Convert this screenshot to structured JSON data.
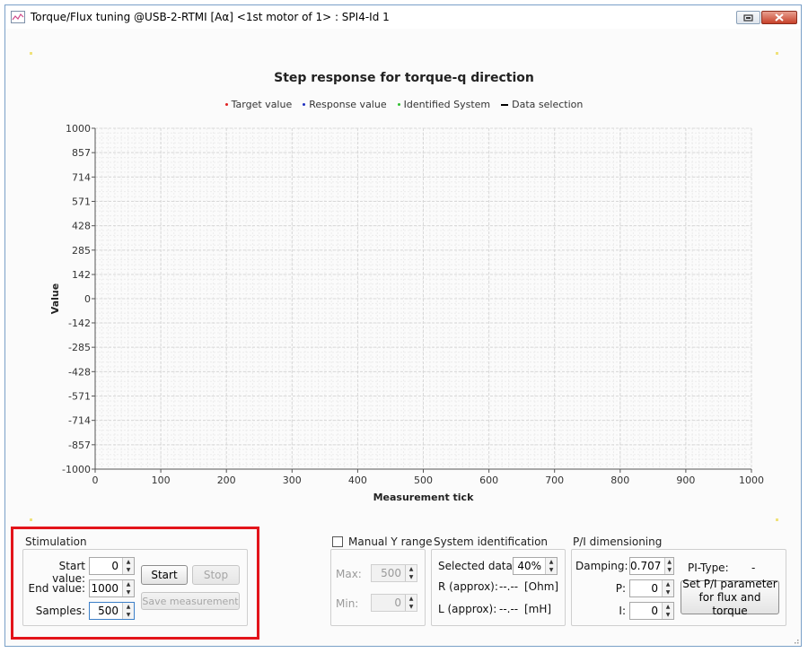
{
  "window": {
    "title": "Torque/Flux tuning @USB-2-RTMI [Aα] <1st motor of 1> : SPI4-Id 1"
  },
  "chart_data": {
    "type": "line",
    "title": "Step response for torque-q direction",
    "xlabel": "Measurement tick",
    "ylabel": "Value",
    "xlim": [
      0,
      1000
    ],
    "ylim": [
      -1000,
      1000
    ],
    "x_ticks": [
      "0",
      "100",
      "200",
      "300",
      "400",
      "500",
      "600",
      "700",
      "800",
      "900",
      "1000"
    ],
    "y_ticks": [
      "1000",
      "857",
      "714",
      "571",
      "428",
      "285",
      "142",
      "0",
      "-142",
      "-285",
      "-428",
      "-571",
      "-714",
      "-857",
      "-1000"
    ],
    "grid": true,
    "legend_position": "top-center",
    "series": [
      {
        "name": "Target value",
        "color": "#e02020",
        "values": []
      },
      {
        "name": "Response value",
        "color": "#2030c0",
        "values": []
      },
      {
        "name": "Identified System",
        "color": "#30c030",
        "values": []
      },
      {
        "name": "Data selection",
        "color": "#000000",
        "values": []
      }
    ]
  },
  "stimulation": {
    "group_label": "Stimulation",
    "start_label": "Start value:",
    "start_value": "0",
    "end_label": "End value:",
    "end_value": "1000",
    "samples_label": "Samples:",
    "samples_value": "500",
    "start_button": "Start",
    "stop_button": "Stop",
    "save_button": "Save measurement"
  },
  "yrange": {
    "checkbox_label": "Manual Y  range",
    "max_label": "Max:",
    "max_value": "500",
    "min_label": "Min:",
    "min_value": "0"
  },
  "sysid": {
    "group_label": "System identification",
    "selected_label": "Selected data:",
    "selected_value": "40%",
    "r_label": "R (approx):",
    "r_value": "--.--",
    "r_unit": "[Ohm]",
    "l_label": "L (approx):",
    "l_value": "--.--",
    "l_unit": "[mH]"
  },
  "pi": {
    "group_label": "P/I dimensioning",
    "damping_label": "Damping:",
    "damping_value": "0.707",
    "pitype_label": "PI-Type:",
    "pitype_value": "-",
    "p_label": "P:",
    "p_value": "0",
    "i_label": "I:",
    "i_value": "0",
    "set_button_line1": "Set P/I parameter",
    "set_button_line2": "for flux and torque"
  }
}
